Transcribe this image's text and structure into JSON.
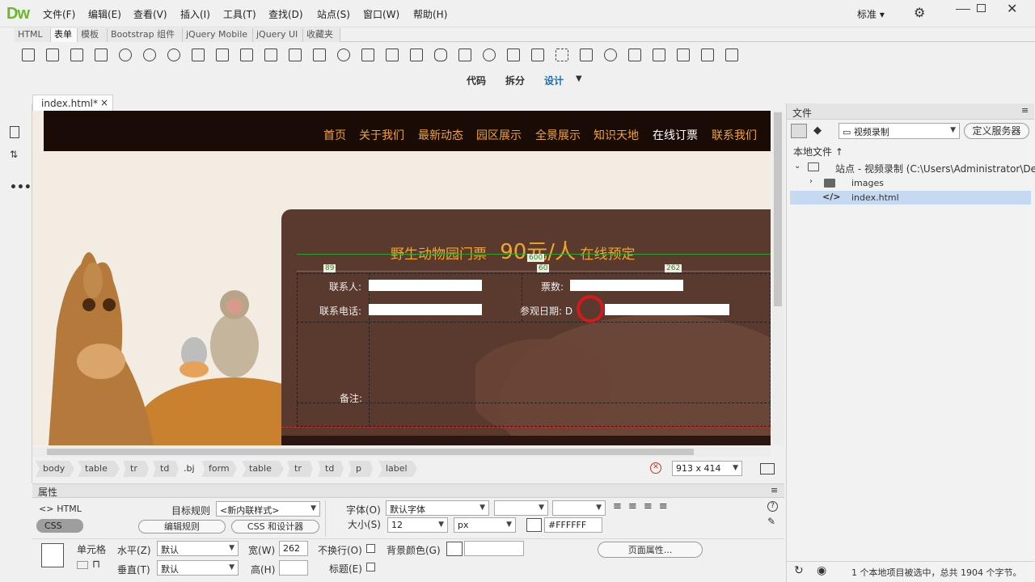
{
  "app": {
    "logo": "Dw",
    "workspace": "标准",
    "gear": "⚙"
  },
  "menu": [
    "文件(F)",
    "编辑(E)",
    "查看(V)",
    "插入(I)",
    "工具(T)",
    "查找(D)",
    "站点(S)",
    "窗口(W)",
    "帮助(H)"
  ],
  "insert_tabs": [
    "HTML",
    "表单",
    "模板",
    "Bootstrap 组件",
    "jQuery Mobile",
    "jQuery UI",
    "收藏夹"
  ],
  "views": {
    "code": "代码",
    "split": "拆分",
    "design": "设计"
  },
  "doc_tab": {
    "label": "index.html*",
    "close": "×"
  },
  "page": {
    "nav": [
      "首页",
      "关于我们",
      "最新动态",
      "园区展示",
      "全景展示",
      "知识天地",
      "在线订票",
      "联系我们"
    ],
    "form_title": "野生动物园门票",
    "price": "90元/人",
    "suffix": "在线预定",
    "widths": {
      "table": "600",
      "c1": "89",
      "c3": "60",
      "c4": "262"
    },
    "labels": {
      "contact": "联系人:",
      "tickets": "票数:",
      "phone": "联系电话:",
      "date": "参观日期:",
      "date_typed": "D",
      "remark": "备注:"
    }
  },
  "statusbar": {
    "crumbs": [
      "body",
      "table",
      "tr",
      "td",
      ".bj",
      "form",
      "table",
      "tr",
      "td",
      "p",
      "label"
    ],
    "size": "913 x 414"
  },
  "files_panel": {
    "title": "文件",
    "site": "视频录制",
    "define_server": "定义服务器",
    "local_files": "本地文件 ↑",
    "root": "站点 - 视频录制 (C:\\Users\\Administrator\\Deskt...",
    "folder": "images",
    "file": "index.html",
    "status": "1 个本地项目被选中，总共 1904 个字节。"
  },
  "properties": {
    "title": "属性",
    "html": "HTML",
    "css": "CSS",
    "target_rule_label": "目标规则",
    "target_rule": "<新内联样式>",
    "edit_rule": "编辑规则",
    "css_designer": "CSS 和设计器",
    "font_label": "字体(O)",
    "font": "默认字体",
    "size_label": "大小(S)",
    "size": "12",
    "unit": "px",
    "color": "#FFFFFF",
    "cell": "单元格",
    "horz_label": "水平(Z)",
    "horz": "默认",
    "vert_label": "垂直(T)",
    "vert": "默认",
    "width_label": "宽(W)",
    "width": "262",
    "height_label": "高(H)",
    "height": "",
    "nowrap": "不换行(O)",
    "header": "标题(E)",
    "bg": "背景颜色(G)",
    "page_props": "页面属性..."
  },
  "colors": {
    "nav_bg": "#1a0b06",
    "form_bg": "#5a3a2e",
    "accent": "#f0a52e",
    "selected": "#c5d9f1"
  }
}
